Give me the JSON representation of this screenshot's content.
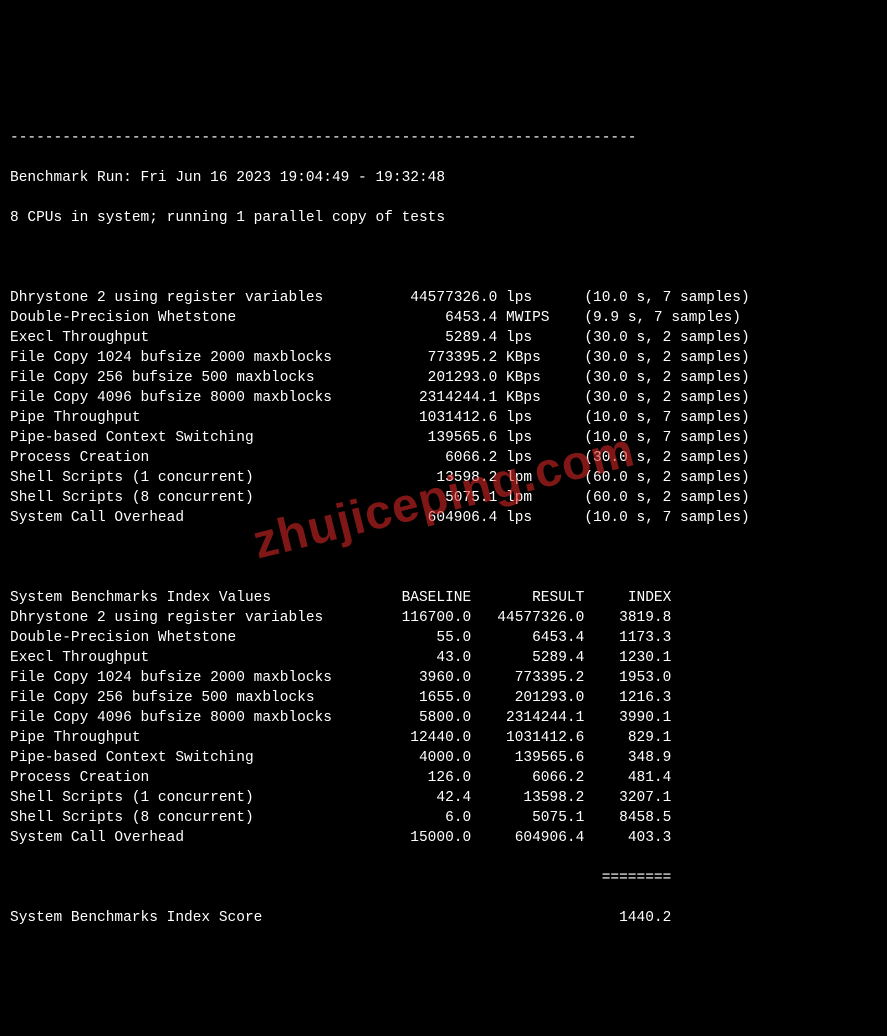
{
  "watermark": "zhujiceping.com",
  "separator_top": "------------------------------------------------------------------------",
  "run_line": "Benchmark Run: Fri Jun 16 2023 19:04:49 - 19:32:48",
  "cpu_line": "8 CPUs in system; running 1 parallel copy of tests",
  "tests": [
    {
      "name": "Dhrystone 2 using register variables",
      "value": "44577326.0",
      "unit": "lps",
      "timing": "(10.0 s, 7 samples)"
    },
    {
      "name": "Double-Precision Whetstone",
      "value": "6453.4",
      "unit": "MWIPS",
      "timing": "(9.9 s, 7 samples)"
    },
    {
      "name": "Execl Throughput",
      "value": "5289.4",
      "unit": "lps",
      "timing": "(30.0 s, 2 samples)"
    },
    {
      "name": "File Copy 1024 bufsize 2000 maxblocks",
      "value": "773395.2",
      "unit": "KBps",
      "timing": "(30.0 s, 2 samples)"
    },
    {
      "name": "File Copy 256 bufsize 500 maxblocks",
      "value": "201293.0",
      "unit": "KBps",
      "timing": "(30.0 s, 2 samples)"
    },
    {
      "name": "File Copy 4096 bufsize 8000 maxblocks",
      "value": "2314244.1",
      "unit": "KBps",
      "timing": "(30.0 s, 2 samples)"
    },
    {
      "name": "Pipe Throughput",
      "value": "1031412.6",
      "unit": "lps",
      "timing": "(10.0 s, 7 samples)"
    },
    {
      "name": "Pipe-based Context Switching",
      "value": "139565.6",
      "unit": "lps",
      "timing": "(10.0 s, 7 samples)"
    },
    {
      "name": "Process Creation",
      "value": "6066.2",
      "unit": "lps",
      "timing": "(30.0 s, 2 samples)"
    },
    {
      "name": "Shell Scripts (1 concurrent)",
      "value": "13598.2",
      "unit": "lpm",
      "timing": "(60.0 s, 2 samples)"
    },
    {
      "name": "Shell Scripts (8 concurrent)",
      "value": "5075.1",
      "unit": "lpm",
      "timing": "(60.0 s, 2 samples)"
    },
    {
      "name": "System Call Overhead",
      "value": "604906.4",
      "unit": "lps",
      "timing": "(10.0 s, 7 samples)"
    }
  ],
  "index_header": {
    "label": "System Benchmarks Index Values",
    "baseline": "BASELINE",
    "result": "RESULT",
    "index": "INDEX"
  },
  "index_rows": [
    {
      "name": "Dhrystone 2 using register variables",
      "baseline": "116700.0",
      "result": "44577326.0",
      "index": "3819.8"
    },
    {
      "name": "Double-Precision Whetstone",
      "baseline": "55.0",
      "result": "6453.4",
      "index": "1173.3"
    },
    {
      "name": "Execl Throughput",
      "baseline": "43.0",
      "result": "5289.4",
      "index": "1230.1"
    },
    {
      "name": "File Copy 1024 bufsize 2000 maxblocks",
      "baseline": "3960.0",
      "result": "773395.2",
      "index": "1953.0"
    },
    {
      "name": "File Copy 256 bufsize 500 maxblocks",
      "baseline": "1655.0",
      "result": "201293.0",
      "index": "1216.3"
    },
    {
      "name": "File Copy 4096 bufsize 8000 maxblocks",
      "baseline": "5800.0",
      "result": "2314244.1",
      "index": "3990.1"
    },
    {
      "name": "Pipe Throughput",
      "baseline": "12440.0",
      "result": "1031412.6",
      "index": "829.1"
    },
    {
      "name": "Pipe-based Context Switching",
      "baseline": "4000.0",
      "result": "139565.6",
      "index": "348.9"
    },
    {
      "name": "Process Creation",
      "baseline": "126.0",
      "result": "6066.2",
      "index": "481.4"
    },
    {
      "name": "Shell Scripts (1 concurrent)",
      "baseline": "42.4",
      "result": "13598.2",
      "index": "3207.1"
    },
    {
      "name": "Shell Scripts (8 concurrent)",
      "baseline": "6.0",
      "result": "5075.1",
      "index": "8458.5"
    },
    {
      "name": "System Call Overhead",
      "baseline": "15000.0",
      "result": "604906.4",
      "index": "403.3"
    }
  ],
  "score_separator": "========",
  "score": {
    "label": "System Benchmarks Index Score",
    "value": "1440.2"
  }
}
